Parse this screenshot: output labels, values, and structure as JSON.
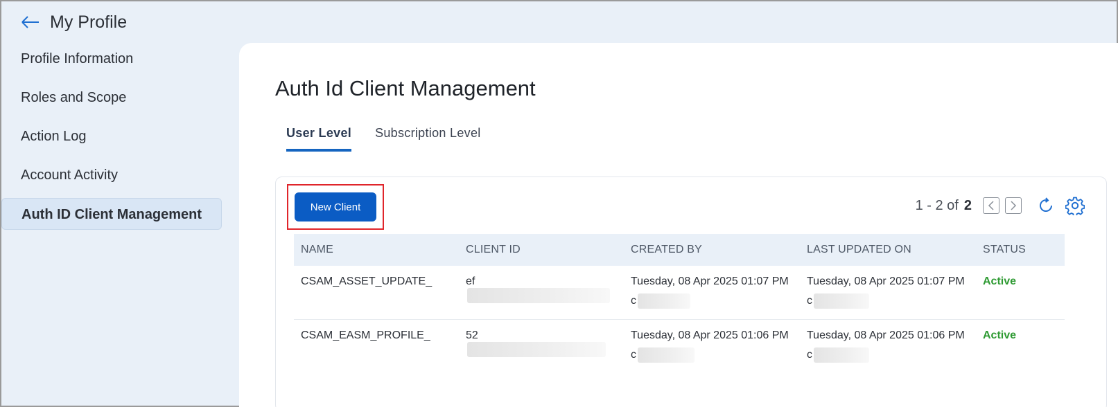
{
  "header": {
    "title": "My Profile",
    "back_icon": "arrow-left-icon"
  },
  "sidebar": {
    "items": [
      {
        "label": "Profile Information",
        "active": false
      },
      {
        "label": "Roles and Scope",
        "active": false
      },
      {
        "label": "Action Log",
        "active": false
      },
      {
        "label": "Account Activity",
        "active": false
      },
      {
        "label": "Auth ID Client Management",
        "active": true
      }
    ]
  },
  "main": {
    "title": "Auth Id Client Management",
    "tabs": [
      {
        "label": "User Level",
        "active": true
      },
      {
        "label": "Subscription Level",
        "active": false
      }
    ],
    "new_client_label": "New Client",
    "pager": {
      "range": "1 - 2 of",
      "total": "2"
    },
    "table": {
      "columns": [
        "NAME",
        "CLIENT ID",
        "CREATED BY",
        "LAST UPDATED ON",
        "STATUS"
      ],
      "rows": [
        {
          "name": "CSAM_ASSET_UPDATE_",
          "client_id": "ef",
          "created_on": "Tuesday, 08 Apr 2025 01:07 PM",
          "created_by": "c",
          "updated_on": "Tuesday, 08 Apr 2025 01:07 PM",
          "updated_by": "c",
          "status": "Active"
        },
        {
          "name": "CSAM_EASM_PROFILE_",
          "client_id": "52",
          "created_on": "Tuesday, 08 Apr 2025 01:06 PM",
          "created_by": "c",
          "updated_on": "Tuesday, 08 Apr 2025 01:06 PM",
          "updated_by": "c",
          "status": "Active"
        }
      ]
    }
  },
  "colors": {
    "accent": "#0b5cc4",
    "status_active": "#2e9a32",
    "highlight_box": "#e0252b"
  }
}
